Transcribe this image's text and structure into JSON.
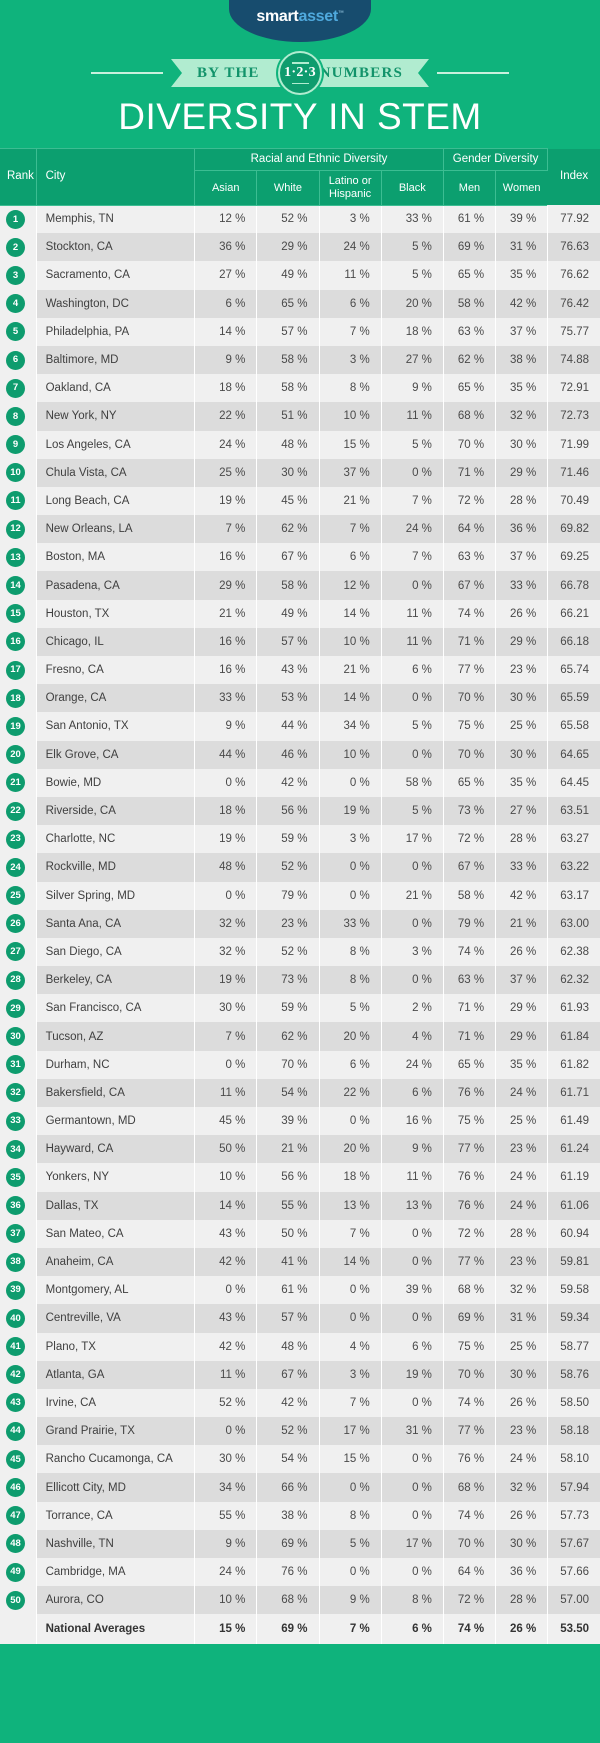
{
  "brand": {
    "logo_smart": "smart",
    "logo_asset": "asset",
    "logo_tm": "™",
    "logo_bg": "#174c6e"
  },
  "ribbon": {
    "text_before": "BY THE",
    "text_after": "NUMBERS",
    "badge_number": "1·2·3"
  },
  "title": "DIVERSITY IN STEM",
  "colors": {
    "background": "#0fb37c",
    "header": "#0c9f6f",
    "accent": "#0e9c6e",
    "row_odd": "#f0f0f0",
    "row_even": "#dcdcdc",
    "ribbon_band": "#b1ecd0"
  },
  "table": {
    "headers": {
      "rank": "Rank",
      "city": "City",
      "racial_group": "Racial and Ethnic Diversity",
      "gender_group": "Gender Diversity",
      "index": "Index",
      "asian": "Asian",
      "white": "White",
      "latino": "Latino or Hispanic",
      "black": "Black",
      "men": "Men",
      "women": "Women"
    },
    "rows": [
      {
        "rank": "1",
        "city": "Memphis, TN",
        "asian": "12 %",
        "white": "52 %",
        "latino": "3 %",
        "black": "33 %",
        "men": "61 %",
        "women": "39 %",
        "index": "77.92"
      },
      {
        "rank": "2",
        "city": "Stockton, CA",
        "asian": "36 %",
        "white": "29 %",
        "latino": "24 %",
        "black": "5 %",
        "men": "69 %",
        "women": "31 %",
        "index": "76.63"
      },
      {
        "rank": "3",
        "city": "Sacramento, CA",
        "asian": "27 %",
        "white": "49 %",
        "latino": "11 %",
        "black": "5 %",
        "men": "65 %",
        "women": "35 %",
        "index": "76.62"
      },
      {
        "rank": "4",
        "city": "Washington, DC",
        "asian": "6 %",
        "white": "65 %",
        "latino": "6 %",
        "black": "20 %",
        "men": "58 %",
        "women": "42 %",
        "index": "76.42"
      },
      {
        "rank": "5",
        "city": "Philadelphia, PA",
        "asian": "14 %",
        "white": "57 %",
        "latino": "7 %",
        "black": "18 %",
        "men": "63 %",
        "women": "37 %",
        "index": "75.77"
      },
      {
        "rank": "6",
        "city": "Baltimore, MD",
        "asian": "9 %",
        "white": "58 %",
        "latino": "3 %",
        "black": "27 %",
        "men": "62 %",
        "women": "38 %",
        "index": "74.88"
      },
      {
        "rank": "7",
        "city": "Oakland, CA",
        "asian": "18 %",
        "white": "58 %",
        "latino": "8 %",
        "black": "9 %",
        "men": "65 %",
        "women": "35 %",
        "index": "72.91"
      },
      {
        "rank": "8",
        "city": "New York, NY",
        "asian": "22 %",
        "white": "51 %",
        "latino": "10 %",
        "black": "11 %",
        "men": "68 %",
        "women": "32 %",
        "index": "72.73"
      },
      {
        "rank": "9",
        "city": "Los Angeles, CA",
        "asian": "24 %",
        "white": "48 %",
        "latino": "15 %",
        "black": "5 %",
        "men": "70 %",
        "women": "30 %",
        "index": "71.99"
      },
      {
        "rank": "10",
        "city": "Chula Vista, CA",
        "asian": "25 %",
        "white": "30 %",
        "latino": "37 %",
        "black": "0 %",
        "men": "71 %",
        "women": "29 %",
        "index": "71.46"
      },
      {
        "rank": "11",
        "city": "Long Beach, CA",
        "asian": "19 %",
        "white": "45 %",
        "latino": "21 %",
        "black": "7 %",
        "men": "72 %",
        "women": "28 %",
        "index": "70.49"
      },
      {
        "rank": "12",
        "city": "New Orleans, LA",
        "asian": "7 %",
        "white": "62 %",
        "latino": "7 %",
        "black": "24 %",
        "men": "64 %",
        "women": "36 %",
        "index": "69.82"
      },
      {
        "rank": "13",
        "city": "Boston, MA",
        "asian": "16 %",
        "white": "67 %",
        "latino": "6 %",
        "black": "7 %",
        "men": "63 %",
        "women": "37 %",
        "index": "69.25"
      },
      {
        "rank": "14",
        "city": "Pasadena, CA",
        "asian": "29 %",
        "white": "58 %",
        "latino": "12 %",
        "black": "0 %",
        "men": "67 %",
        "women": "33 %",
        "index": "66.78"
      },
      {
        "rank": "15",
        "city": "Houston, TX",
        "asian": "21 %",
        "white": "49 %",
        "latino": "14 %",
        "black": "11 %",
        "men": "74 %",
        "women": "26 %",
        "index": "66.21"
      },
      {
        "rank": "16",
        "city": "Chicago, IL",
        "asian": "16 %",
        "white": "57 %",
        "latino": "10 %",
        "black": "11 %",
        "men": "71 %",
        "women": "29 %",
        "index": "66.18"
      },
      {
        "rank": "17",
        "city": "Fresno, CA",
        "asian": "16 %",
        "white": "43 %",
        "latino": "21 %",
        "black": "6 %",
        "men": "77 %",
        "women": "23 %",
        "index": "65.74"
      },
      {
        "rank": "18",
        "city": "Orange, CA",
        "asian": "33 %",
        "white": "53 %",
        "latino": "14 %",
        "black": "0 %",
        "men": "70 %",
        "women": "30 %",
        "index": "65.59"
      },
      {
        "rank": "19",
        "city": "San Antonio, TX",
        "asian": "9 %",
        "white": "44 %",
        "latino": "34 %",
        "black": "5 %",
        "men": "75 %",
        "women": "25 %",
        "index": "65.58"
      },
      {
        "rank": "20",
        "city": "Elk Grove, CA",
        "asian": "44 %",
        "white": "46 %",
        "latino": "10 %",
        "black": "0 %",
        "men": "70 %",
        "women": "30 %",
        "index": "64.65"
      },
      {
        "rank": "21",
        "city": "Bowie, MD",
        "asian": "0 %",
        "white": "42 %",
        "latino": "0 %",
        "black": "58 %",
        "men": "65 %",
        "women": "35 %",
        "index": "64.45"
      },
      {
        "rank": "22",
        "city": "Riverside, CA",
        "asian": "18 %",
        "white": "56 %",
        "latino": "19 %",
        "black": "5 %",
        "men": "73 %",
        "women": "27 %",
        "index": "63.51"
      },
      {
        "rank": "23",
        "city": "Charlotte, NC",
        "asian": "19 %",
        "white": "59 %",
        "latino": "3 %",
        "black": "17 %",
        "men": "72 %",
        "women": "28 %",
        "index": "63.27"
      },
      {
        "rank": "24",
        "city": "Rockville, MD",
        "asian": "48 %",
        "white": "52 %",
        "latino": "0 %",
        "black": "0 %",
        "men": "67 %",
        "women": "33 %",
        "index": "63.22"
      },
      {
        "rank": "25",
        "city": "Silver Spring, MD",
        "asian": "0 %",
        "white": "79 %",
        "latino": "0 %",
        "black": "21 %",
        "men": "58 %",
        "women": "42 %",
        "index": "63.17"
      },
      {
        "rank": "26",
        "city": "Santa Ana, CA",
        "asian": "32 %",
        "white": "23 %",
        "latino": "33 %",
        "black": "0 %",
        "men": "79 %",
        "women": "21 %",
        "index": "63.00"
      },
      {
        "rank": "27",
        "city": "San Diego, CA",
        "asian": "32 %",
        "white": "52 %",
        "latino": "8 %",
        "black": "3 %",
        "men": "74 %",
        "women": "26 %",
        "index": "62.38"
      },
      {
        "rank": "28",
        "city": "Berkeley, CA",
        "asian": "19 %",
        "white": "73 %",
        "latino": "8 %",
        "black": "0 %",
        "men": "63 %",
        "women": "37 %",
        "index": "62.32"
      },
      {
        "rank": "29",
        "city": "San Francisco, CA",
        "asian": "30 %",
        "white": "59 %",
        "latino": "5 %",
        "black": "2 %",
        "men": "71 %",
        "women": "29 %",
        "index": "61.93"
      },
      {
        "rank": "30",
        "city": "Tucson, AZ",
        "asian": "7 %",
        "white": "62 %",
        "latino": "20 %",
        "black": "4 %",
        "men": "71 %",
        "women": "29 %",
        "index": "61.84"
      },
      {
        "rank": "31",
        "city": "Durham, NC",
        "asian": "0 %",
        "white": "70 %",
        "latino": "6 %",
        "black": "24 %",
        "men": "65 %",
        "women": "35 %",
        "index": "61.82"
      },
      {
        "rank": "32",
        "city": "Bakersfield, CA",
        "asian": "11 %",
        "white": "54 %",
        "latino": "22 %",
        "black": "6 %",
        "men": "76 %",
        "women": "24 %",
        "index": "61.71"
      },
      {
        "rank": "33",
        "city": "Germantown, MD",
        "asian": "45 %",
        "white": "39 %",
        "latino": "0 %",
        "black": "16 %",
        "men": "75 %",
        "women": "25 %",
        "index": "61.49"
      },
      {
        "rank": "34",
        "city": "Hayward, CA",
        "asian": "50 %",
        "white": "21 %",
        "latino": "20 %",
        "black": "9 %",
        "men": "77 %",
        "women": "23 %",
        "index": "61.24"
      },
      {
        "rank": "35",
        "city": "Yonkers, NY",
        "asian": "10 %",
        "white": "56 %",
        "latino": "18 %",
        "black": "11 %",
        "men": "76 %",
        "women": "24 %",
        "index": "61.19"
      },
      {
        "rank": "36",
        "city": "Dallas, TX",
        "asian": "14 %",
        "white": "55 %",
        "latino": "13 %",
        "black": "13 %",
        "men": "76 %",
        "women": "24 %",
        "index": "61.06"
      },
      {
        "rank": "37",
        "city": "San Mateo, CA",
        "asian": "43 %",
        "white": "50 %",
        "latino": "7 %",
        "black": "0 %",
        "men": "72 %",
        "women": "28 %",
        "index": "60.94"
      },
      {
        "rank": "38",
        "city": "Anaheim, CA",
        "asian": "42 %",
        "white": "41 %",
        "latino": "14 %",
        "black": "0 %",
        "men": "77 %",
        "women": "23 %",
        "index": "59.81"
      },
      {
        "rank": "39",
        "city": "Montgomery, AL",
        "asian": "0 %",
        "white": "61 %",
        "latino": "0 %",
        "black": "39 %",
        "men": "68 %",
        "women": "32 %",
        "index": "59.58"
      },
      {
        "rank": "40",
        "city": "Centreville, VA",
        "asian": "43 %",
        "white": "57 %",
        "latino": "0 %",
        "black": "0 %",
        "men": "69 %",
        "women": "31 %",
        "index": "59.34"
      },
      {
        "rank": "41",
        "city": "Plano, TX",
        "asian": "42 %",
        "white": "48 %",
        "latino": "4 %",
        "black": "6 %",
        "men": "75 %",
        "women": "25 %",
        "index": "58.77"
      },
      {
        "rank": "42",
        "city": "Atlanta, GA",
        "asian": "11 %",
        "white": "67 %",
        "latino": "3 %",
        "black": "19 %",
        "men": "70 %",
        "women": "30 %",
        "index": "58.76"
      },
      {
        "rank": "43",
        "city": "Irvine, CA",
        "asian": "52 %",
        "white": "42 %",
        "latino": "7 %",
        "black": "0 %",
        "men": "74 %",
        "women": "26 %",
        "index": "58.50"
      },
      {
        "rank": "44",
        "city": "Grand Prairie, TX",
        "asian": "0 %",
        "white": "52 %",
        "latino": "17 %",
        "black": "31 %",
        "men": "77 %",
        "women": "23 %",
        "index": "58.18"
      },
      {
        "rank": "45",
        "city": "Rancho Cucamonga, CA",
        "asian": "30 %",
        "white": "54 %",
        "latino": "15 %",
        "black": "0 %",
        "men": "76 %",
        "women": "24 %",
        "index": "58.10"
      },
      {
        "rank": "46",
        "city": "Ellicott City, MD",
        "asian": "34 %",
        "white": "66 %",
        "latino": "0 %",
        "black": "0 %",
        "men": "68 %",
        "women": "32 %",
        "index": "57.94"
      },
      {
        "rank": "47",
        "city": "Torrance, CA",
        "asian": "55 %",
        "white": "38 %",
        "latino": "8 %",
        "black": "0 %",
        "men": "74 %",
        "women": "26 %",
        "index": "57.73"
      },
      {
        "rank": "48",
        "city": "Nashville, TN",
        "asian": "9 %",
        "white": "69 %",
        "latino": "5 %",
        "black": "17 %",
        "men": "70 %",
        "women": "30 %",
        "index": "57.67"
      },
      {
        "rank": "49",
        "city": "Cambridge, MA",
        "asian": "24 %",
        "white": "76 %",
        "latino": "0 %",
        "black": "0 %",
        "men": "64 %",
        "women": "36 %",
        "index": "57.66"
      },
      {
        "rank": "50",
        "city": "Aurora, CO",
        "asian": "10 %",
        "white": "68 %",
        "latino": "9 %",
        "black": "8 %",
        "men": "72 %",
        "women": "28 %",
        "index": "57.00"
      }
    ],
    "footer": {
      "rank": "",
      "city": "National Averages",
      "asian": "15 %",
      "white": "69 %",
      "latino": "7 %",
      "black": "6 %",
      "men": "74 %",
      "women": "26 %",
      "index": "53.50"
    }
  }
}
